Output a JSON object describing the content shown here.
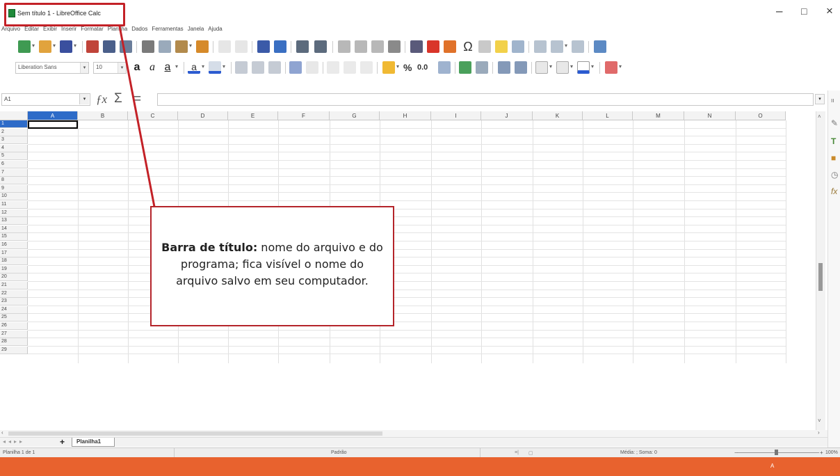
{
  "window": {
    "title": "Sem título 1 - LibreOffice Calc",
    "minimize_glyph": "–",
    "maximize_glyph": "□",
    "close_glyph": "×"
  },
  "menu": [
    "Arquivo",
    "Editar",
    "Exibir",
    "Inserir",
    "Formatar",
    "Planilha",
    "Dados",
    "Ferramentas",
    "Janela",
    "Ajuda"
  ],
  "format_bar": {
    "font_name": "Liberation Sans",
    "font_size": "10",
    "percent_label": "%",
    "decimal_label": "0.0"
  },
  "formula_bar": {
    "name_box": "A1",
    "formula_value": ""
  },
  "columns": [
    "A",
    "B",
    "C",
    "D",
    "E",
    "F",
    "G",
    "H",
    "I",
    "J",
    "K",
    "L",
    "M",
    "N",
    "O"
  ],
  "rows": [
    "1",
    "2",
    "3",
    "4",
    "5",
    "6",
    "7",
    "8",
    "9",
    "10",
    "11",
    "12",
    "13",
    "14",
    "15",
    "16",
    "17",
    "18",
    "19",
    "20",
    "21",
    "22",
    "23",
    "24",
    "25",
    "26",
    "27",
    "28",
    "29"
  ],
  "selected_cell": {
    "column": "A",
    "row": "1"
  },
  "sheets": {
    "add_label": "+",
    "active_tab": "Planilha1"
  },
  "status": {
    "sheet_position": "Planilha 1 de 1",
    "page_style": "Padrão",
    "summary": "Média: ; Soma: 0",
    "zoom": "100%"
  },
  "callout": {
    "bold": "Barra de título:",
    "text": " nome do arquivo e do programa; fica visível o nome do arquivo salvo em seu computador."
  },
  "colors": {
    "highlight_red": "#c32127",
    "selection_blue": "#2d6bc8",
    "taskbar_orange": "#e8622e"
  },
  "taskbar": {
    "label": "A"
  }
}
